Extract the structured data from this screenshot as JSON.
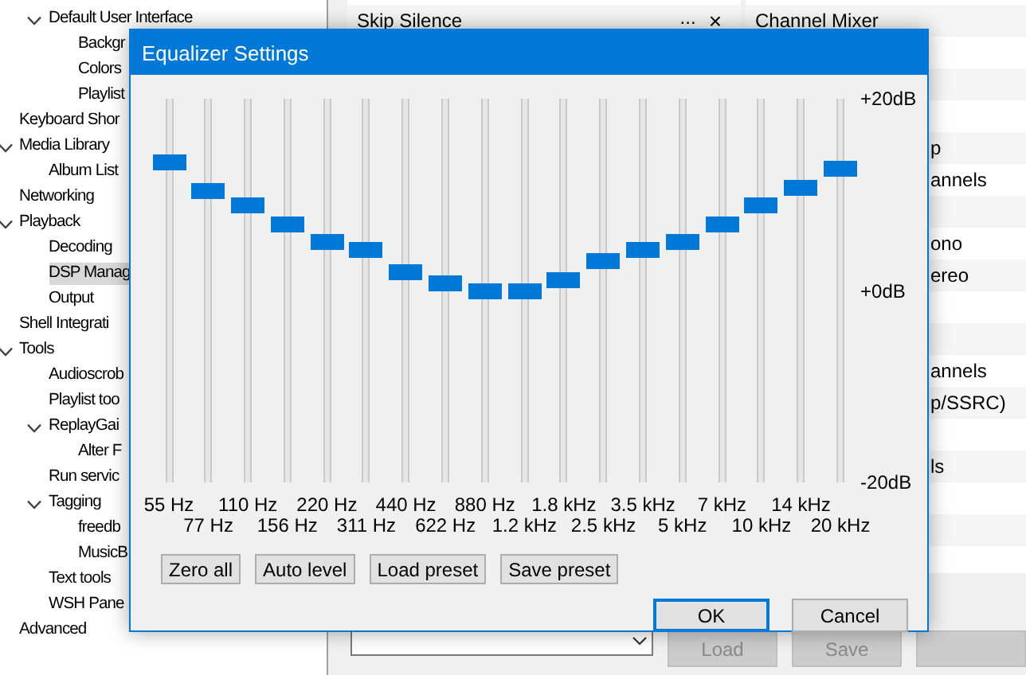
{
  "tree": {
    "continued": [
      {
        "label": "Default User Interface",
        "selected": false,
        "expanded": true,
        "children": [
          {
            "label": "Backgr",
            "selected": false
          },
          {
            "label": "Colors",
            "selected": false
          },
          {
            "label": "Playlist",
            "selected": false
          }
        ]
      }
    ],
    "items": [
      {
        "label": "Keyboard Shor",
        "selected": false
      },
      {
        "label": "Media Library",
        "selected": false,
        "expanded": true,
        "children": [
          {
            "label": "Album List",
            "selected": false
          }
        ]
      },
      {
        "label": "Networking",
        "selected": false
      },
      {
        "label": "Playback",
        "selected": false,
        "expanded": true,
        "children": [
          {
            "label": "Decoding",
            "selected": false
          },
          {
            "label": "DSP Manag",
            "selected": true
          },
          {
            "label": "Output",
            "selected": false
          }
        ]
      },
      {
        "label": "Shell Integrati",
        "selected": false
      },
      {
        "label": "Tools",
        "selected": false,
        "expanded": true,
        "children": [
          {
            "label": "Audioscrob",
            "selected": false
          },
          {
            "label": "Playlist too",
            "selected": false
          },
          {
            "label": "ReplayGai",
            "selected": false,
            "expanded": true,
            "children": [
              {
                "label": "Alter F",
                "selected": false
              }
            ]
          },
          {
            "label": "Run servic",
            "selected": false
          },
          {
            "label": "Tagging",
            "selected": false,
            "expanded": true,
            "children": [
              {
                "label": "freedb",
                "selected": false
              },
              {
                "label": "MusicB",
                "selected": false
              }
            ]
          },
          {
            "label": "Text tools",
            "selected": false
          },
          {
            "label": "WSH Pane",
            "selected": false
          }
        ]
      },
      {
        "label": "Advanced",
        "selected": false
      }
    ]
  },
  "active_dsps": [
    {
      "label": "Skip Silence",
      "menu": "...",
      "remove": "×"
    }
  ],
  "available_dsps": [
    {
      "kind": "text",
      "label": "Channel Mixer"
    },
    {
      "kind": "covered"
    },
    {
      "kind": "covered"
    },
    {
      "kind": "covered"
    },
    {
      "kind": "text",
      "label": "p"
    },
    {
      "kind": "text",
      "label": "annels"
    },
    {
      "kind": "covered"
    },
    {
      "kind": "text",
      "label": "ono"
    },
    {
      "kind": "text",
      "label": "ereo"
    },
    {
      "kind": "covered"
    },
    {
      "kind": "covered"
    },
    {
      "kind": "text",
      "label": "annels"
    },
    {
      "kind": "text",
      "label": "p/SSRC)"
    },
    {
      "kind": "covered"
    },
    {
      "kind": "text",
      "label": "ls"
    },
    {
      "kind": "covered"
    },
    {
      "kind": "covered"
    },
    {
      "kind": "covered"
    }
  ],
  "preset_buttons": [
    {
      "label": "Load",
      "disabled": true
    },
    {
      "label": "Save",
      "disabled": true
    }
  ],
  "dialog": {
    "title": "Equalizer Settings",
    "bands": [
      {
        "label": "55 Hz",
        "level": 0.85
      },
      {
        "label": "77 Hz",
        "level": 0.77
      },
      {
        "label": "110 Hz",
        "level": 0.73
      },
      {
        "label": "156 Hz",
        "level": 0.68
      },
      {
        "label": "220 Hz",
        "level": 0.63
      },
      {
        "label": "311 Hz",
        "level": 0.61
      },
      {
        "label": "440 Hz",
        "level": 0.55
      },
      {
        "label": "622 Hz",
        "level": 0.52
      },
      {
        "label": "880 Hz",
        "level": 0.5
      },
      {
        "label": "1.2 kHz",
        "level": 0.5
      },
      {
        "label": "1.8 kHz",
        "level": 0.53
      },
      {
        "label": "2.5 kHz",
        "level": 0.58
      },
      {
        "label": "3.5 kHz",
        "level": 0.61
      },
      {
        "label": "5 kHz",
        "level": 0.63
      },
      {
        "label": "7 kHz",
        "level": 0.68
      },
      {
        "label": "10 kHz",
        "level": 0.73
      },
      {
        "label": "14 kHz",
        "level": 0.78
      },
      {
        "label": "20 kHz",
        "level": 0.83
      }
    ],
    "scale": [
      "+20dB",
      "+0dB",
      "-20dB"
    ],
    "tools": [
      "Zero all",
      "Auto level",
      "Load preset",
      "Save preset"
    ],
    "actions": [
      {
        "label": "OK",
        "default": true
      },
      {
        "label": "Cancel",
        "default": false
      }
    ]
  }
}
